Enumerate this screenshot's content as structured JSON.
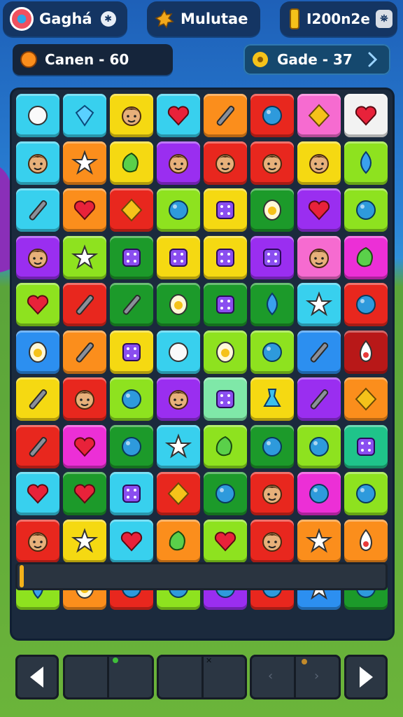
{
  "top_bar": {
    "left_title": "Gaghá",
    "center_title": "Mulutae",
    "right_value": "I200n2e"
  },
  "stats": {
    "left_label": "Canen - 60",
    "right_label": "Gade - 37"
  },
  "colors": {
    "cyan": "#38d0ee",
    "blue": "#2c8ff0",
    "yellow": "#f5d912",
    "orange": "#fb8e1c",
    "red": "#e8271e",
    "green": "#2fbf2a",
    "lime": "#8ee21f",
    "purple": "#9a2ef0",
    "magenta": "#ec2fd6",
    "pink": "#f66bd0",
    "teal": "#1fc48a",
    "dkgreen": "#1c9a2a",
    "white": "#f2f2f2",
    "darkred": "#b81818",
    "mint": "#7fe8a8",
    "indigo": "#3540d8"
  },
  "board": {
    "rows": [
      [
        [
          "cyan",
          "gem-round-icon"
        ],
        [
          "cyan",
          "sapphire-icon"
        ],
        [
          "yellow",
          "face-icon"
        ],
        [
          "cyan",
          "heart-icon"
        ],
        [
          "orange",
          "stick-icon"
        ],
        [
          "red",
          "orb-icon"
        ],
        [
          "pink",
          "diamond-icon"
        ],
        [
          "white",
          "heart-icon"
        ]
      ],
      [
        [
          "cyan",
          "face-icon"
        ],
        [
          "orange",
          "star-icon"
        ],
        [
          "yellow",
          "leaf-icon"
        ],
        [
          "purple",
          "face-icon"
        ],
        [
          "red",
          "face-icon"
        ],
        [
          "red",
          "face-icon"
        ],
        [
          "yellow",
          "face-icon"
        ],
        [
          "lime",
          "drop-icon"
        ]
      ],
      [
        [
          "cyan",
          "stick-icon"
        ],
        [
          "orange",
          "heart-icon"
        ],
        [
          "red",
          "diamond-icon"
        ],
        [
          "lime",
          "orb-icon"
        ],
        [
          "yellow",
          "dice-icon"
        ],
        [
          "dkgreen",
          "egg-icon"
        ],
        [
          "purple",
          "heart-icon"
        ],
        [
          "lime",
          "orb-icon"
        ]
      ],
      [
        [
          "purple",
          "face-icon"
        ],
        [
          "lime",
          "star-icon"
        ],
        [
          "dkgreen",
          "dice-icon"
        ],
        [
          "yellow",
          "dice-icon"
        ],
        [
          "yellow",
          "dice-icon"
        ],
        [
          "purple",
          "dice-icon"
        ],
        [
          "pink",
          "face-icon"
        ],
        [
          "magenta",
          "leaf-icon"
        ]
      ],
      [
        [
          "lime",
          "heart-icon"
        ],
        [
          "red",
          "stick-icon"
        ],
        [
          "dkgreen",
          "stick-icon"
        ],
        [
          "dkgreen",
          "egg-icon"
        ],
        [
          "dkgreen",
          "dice-icon"
        ],
        [
          "dkgreen",
          "drop-icon"
        ],
        [
          "cyan",
          "star-icon"
        ],
        [
          "red",
          "orb-icon"
        ]
      ],
      [
        [
          "blue",
          "egg-icon"
        ],
        [
          "orange",
          "stick-icon"
        ],
        [
          "yellow",
          "dice-icon"
        ],
        [
          "cyan",
          "gem-round-icon"
        ],
        [
          "lime",
          "egg-icon"
        ],
        [
          "lime",
          "orb-icon"
        ],
        [
          "blue",
          "stick-icon"
        ],
        [
          "darkred",
          "flame-icon"
        ]
      ],
      [
        [
          "yellow",
          "stick-icon"
        ],
        [
          "red",
          "face-icon"
        ],
        [
          "lime",
          "orb-icon"
        ],
        [
          "purple",
          "face-icon"
        ],
        [
          "mint",
          "dice-icon"
        ],
        [
          "yellow",
          "flask-icon"
        ],
        [
          "purple",
          "stick-icon"
        ],
        [
          "orange",
          "diamond-icon"
        ]
      ],
      [
        [
          "red",
          "stick-icon"
        ],
        [
          "magenta",
          "heart-icon"
        ],
        [
          "dkgreen",
          "orb-icon"
        ],
        [
          "cyan",
          "star-icon"
        ],
        [
          "lime",
          "leaf-icon"
        ],
        [
          "dkgreen",
          "orb-icon"
        ],
        [
          "lime",
          "orb-icon"
        ],
        [
          "teal",
          "dice-icon"
        ]
      ],
      [
        [
          "cyan",
          "heart-icon"
        ],
        [
          "dkgreen",
          "heart-icon"
        ],
        [
          "cyan",
          "dice-icon"
        ],
        [
          "red",
          "diamond-icon"
        ],
        [
          "dkgreen",
          "orb-icon"
        ],
        [
          "red",
          "face-icon"
        ],
        [
          "magenta",
          "orb-icon"
        ],
        [
          "lime",
          "orb-icon"
        ]
      ],
      [
        [
          "red",
          "face-icon"
        ],
        [
          "yellow",
          "star-icon"
        ],
        [
          "cyan",
          "heart-icon"
        ],
        [
          "orange",
          "leaf-icon"
        ],
        [
          "lime",
          "heart-icon"
        ],
        [
          "red",
          "face-icon"
        ],
        [
          "orange",
          "star-icon"
        ],
        [
          "orange",
          "flame-icon"
        ]
      ],
      [
        [
          "lime",
          "drop-icon"
        ],
        [
          "orange",
          "egg-icon"
        ],
        [
          "red",
          "orb-icon"
        ],
        [
          "lime",
          "orb-icon"
        ],
        [
          "purple",
          "orb-icon"
        ],
        [
          "red",
          "orb-icon"
        ],
        [
          "blue",
          "star-icon"
        ],
        [
          "dkgreen",
          "orb-icon"
        ]
      ]
    ]
  },
  "progress": {
    "fraction": 0.01
  },
  "controls": {
    "prev": "left-arrow-icon",
    "next": "right-arrow-icon"
  }
}
